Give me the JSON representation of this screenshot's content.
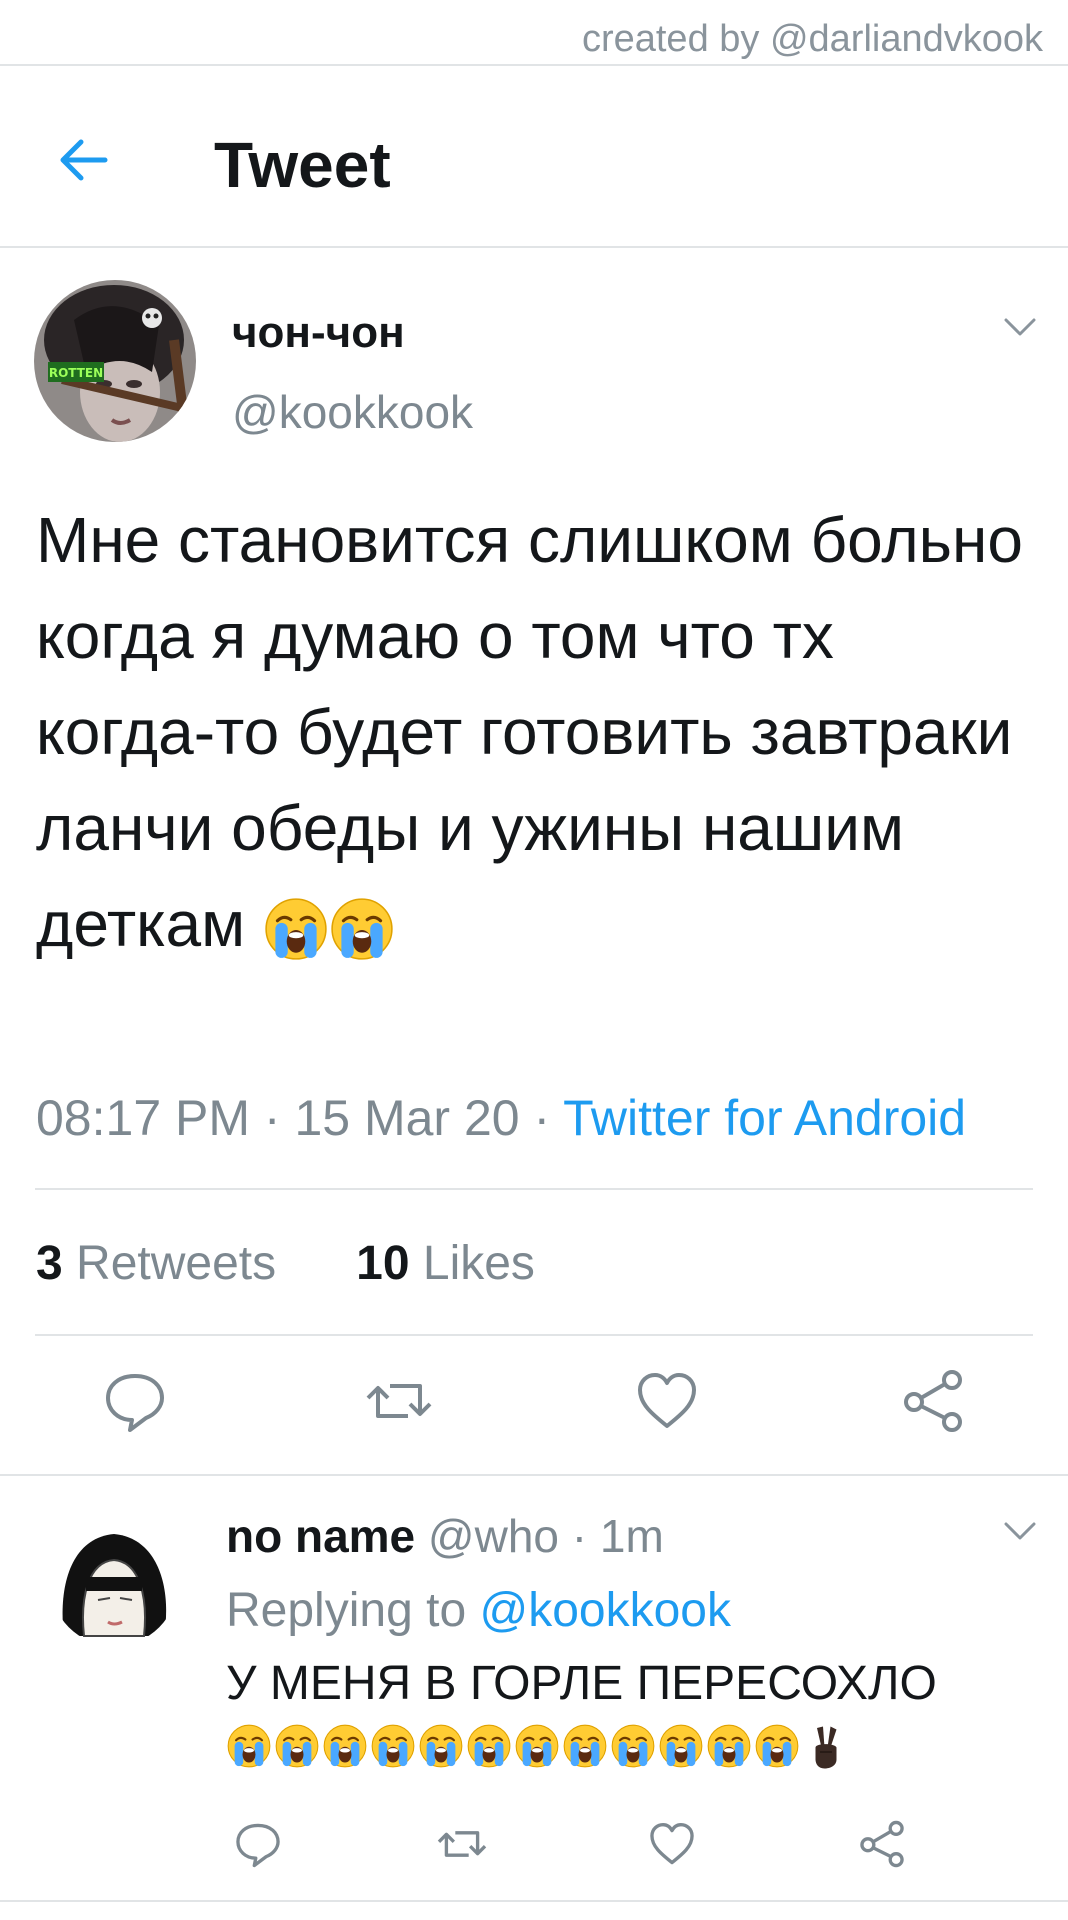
{
  "credit": "created by @darliandvkook",
  "header": {
    "title": "Tweet"
  },
  "tweet": {
    "author_name": "чон-чон",
    "author_handle": "@kookkook",
    "avatar_badge": "ROTTEN",
    "text": "Мне становится слишком больно когда я думаю о том что тх когда-то будет готовить завтраки ланчи обеды и ужины нашим деткам",
    "time": "08:17 PM · 15 Mar 20 · ",
    "source": "Twitter for Android",
    "retweets_count": "3",
    "retweets_label": " Retweets",
    "likes_count": "10",
    "likes_label": " Likes",
    "emoji_count": 2,
    "emoji_name": "loudly-crying-face"
  },
  "reply": {
    "name": "no name",
    "handle_time": " @who · 1m",
    "replying_prefix": "Replying to ",
    "replying_handle": "@kookkook",
    "text": "У МЕНЯ В ГОРЛЕ ПЕРЕСОХЛО",
    "crying_emoji_count": 12,
    "extra_emoji": "victory-hand"
  },
  "colors": {
    "accent": "#1d9bf0",
    "secondary_text": "#7d8890",
    "divider": "#e1e4e6"
  }
}
